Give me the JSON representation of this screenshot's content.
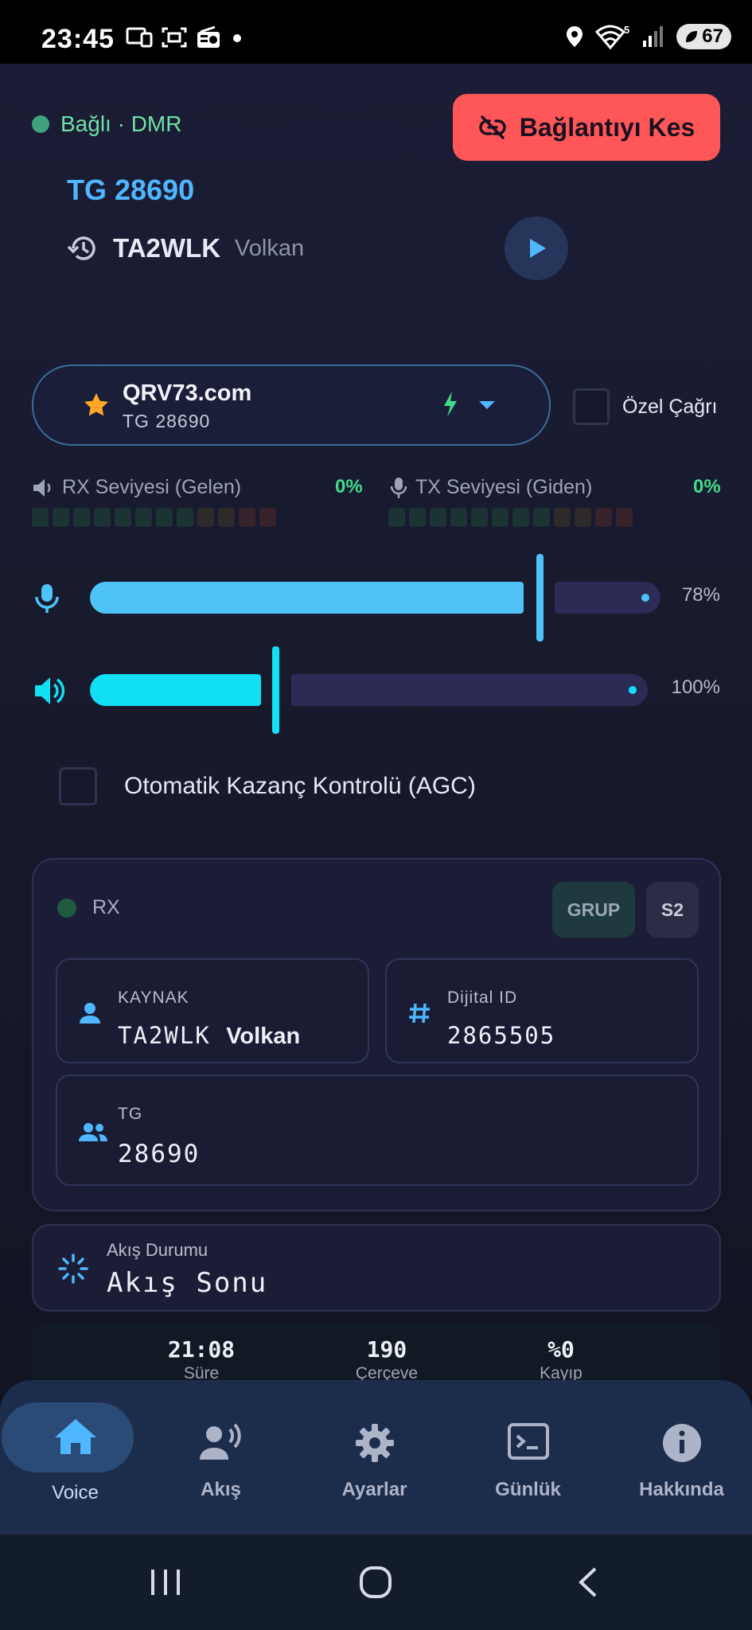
{
  "status_bar": {
    "time": "23:45",
    "left_icons": [
      "cast-icon",
      "screenshot-icon",
      "radio-icon",
      "dot-icon"
    ],
    "right_icons": [
      "location-icon",
      "wifi-icon",
      "signal-icon"
    ],
    "wifi_badge": "5",
    "battery": "67"
  },
  "connection": {
    "status": "Bağlı · DMR",
    "status_color": "#3fa27a",
    "disconnect_label": "Bağlantıyı Kes",
    "disconnect_color": "#ff5757",
    "talkgroup_title": "TG 28690",
    "last_callsign": "TA2WLK",
    "last_name": "Volkan"
  },
  "server": {
    "name": "QRV73.com",
    "tg": "TG 28690"
  },
  "private_call": {
    "label": "Özel Çağrı",
    "checked": false
  },
  "levels": {
    "rx": {
      "label": "RX Seviyesi (Gelen)",
      "value": "0%"
    },
    "tx": {
      "label": "TX Seviyesi (Giden)",
      "value": "0%"
    }
  },
  "sliders": {
    "mic": {
      "value": 78,
      "label": "78%",
      "color": "#4fc3f7"
    },
    "speaker": {
      "value": 100,
      "label": "100%",
      "color": "#12e0f5"
    }
  },
  "agc": {
    "label": "Otomatik Kazanç Kontrolü (AGC)",
    "checked": false
  },
  "rx_card": {
    "label": "RX",
    "chip_group": "GRUP",
    "chip_slot": "S2",
    "source_label": "KAYNAK",
    "source_call": "TA2WLK",
    "source_name": "Volkan",
    "id_label": "Dijital ID",
    "id_value": "2865505",
    "tg_label": "TG",
    "tg_value": "28690"
  },
  "stream": {
    "label": "Akış Durumu",
    "value": "Akış Sonu"
  },
  "stats": [
    {
      "value": "21:08",
      "label": "Süre"
    },
    {
      "value": "190",
      "label": "Çerçeve"
    },
    {
      "value": "%0",
      "label": "Kayıp"
    }
  ],
  "nav": [
    {
      "label": "Voice",
      "icon": "home-icon",
      "active": true
    },
    {
      "label": "Akış",
      "icon": "person-voice-icon",
      "active": false
    },
    {
      "label": "Ayarlar",
      "icon": "gear-icon",
      "active": false
    },
    {
      "label": "Günlük",
      "icon": "terminal-icon",
      "active": false
    },
    {
      "label": "Hakkında",
      "icon": "info-icon",
      "active": false
    }
  ],
  "system_nav": [
    "recents-icon",
    "home-circle-icon",
    "back-icon"
  ]
}
